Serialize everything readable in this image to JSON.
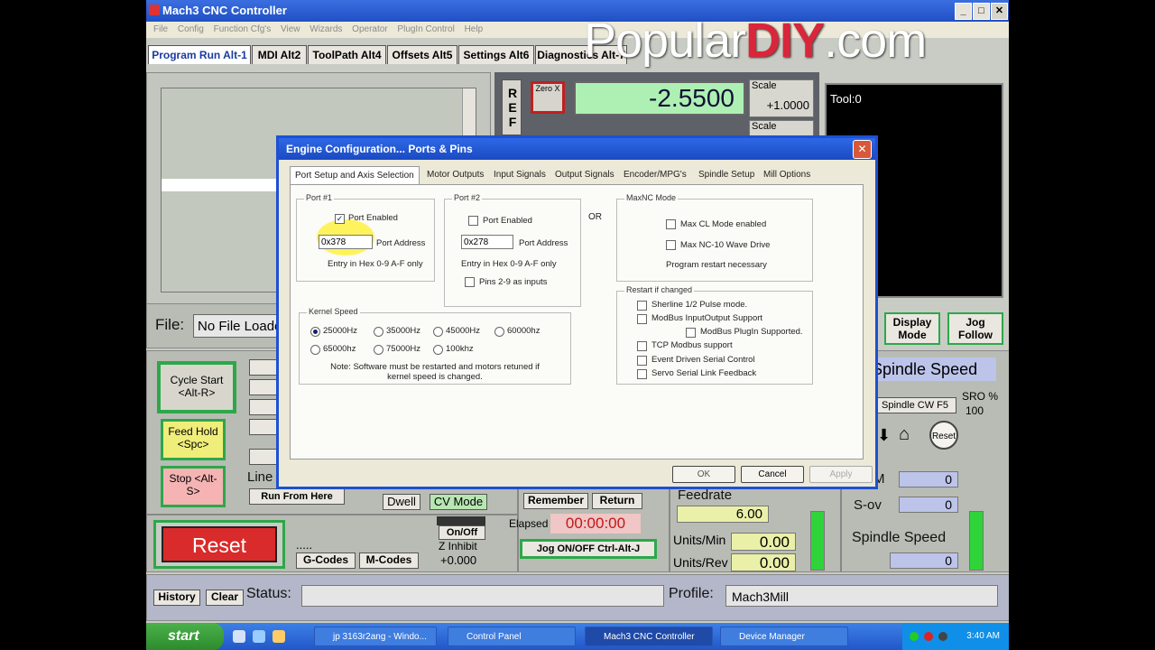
{
  "window": {
    "title": "Mach3 CNC Controller"
  },
  "watermark": {
    "part1": "Popular",
    "part2": "DIY",
    "part3": ".com"
  },
  "menubar": [
    "File",
    "Config",
    "Function Cfg's",
    "View",
    "Wizards",
    "Operator",
    "PlugIn Control",
    "Help"
  ],
  "screen_tabs": [
    {
      "label": "Program Run Alt-1"
    },
    {
      "label": "MDI Alt2"
    },
    {
      "label": "ToolPath Alt4"
    },
    {
      "label": "Offsets Alt5"
    },
    {
      "label": "Settings Alt6"
    },
    {
      "label": "Diagnostics Alt-7"
    }
  ],
  "dro": {
    "ref_label": "REF",
    "zero_x_label": "Zero X",
    "x_value": "-2.5500",
    "scale_label": "Scale",
    "scale_value": "+1.0000",
    "scale_label2": "Scale"
  },
  "tool": {
    "label": "Tool:0"
  },
  "file": {
    "label": "File:",
    "value": "No File Loaded."
  },
  "buttons": {
    "cycle_start": "Cycle Start <Alt-R>",
    "feed_hold": "Feed Hold <Spc>",
    "stop": "Stop <Alt-S>",
    "reset": "Reset",
    "run_from_here": "Run From Here",
    "line_label": "Line",
    "dwell": "Dwell",
    "cv_mode": "CV Mode",
    "remember": "Remember",
    "return": "Return",
    "jog_onoff": "Jog ON/OFF Ctrl-Alt-J",
    "onoff": "On/Off",
    "z_inhibit": "Z Inhibit",
    "z_inhibit_value": "+0.000",
    "gcodes": "G-Codes",
    "mcodes": "M-Codes",
    "display_mode": "Display Mode",
    "jog_follow": "Jog Follow",
    "spindle_cw": "Spindle CW F5",
    "reset_small": "Reset",
    "history": "History",
    "clear": "Clear",
    "dots": "....."
  },
  "elapsed": {
    "label": "Elapsed",
    "value": "00:00:00"
  },
  "feedrate": {
    "label": "Feedrate",
    "value": "6.00",
    "units_min_label": "Units/Min",
    "units_min": "0.00",
    "units_rev_label": "Units/Rev",
    "units_rev": "0.00"
  },
  "spindle": {
    "header": "Spindle Speed",
    "sro_label": "SRO %",
    "sro_value": "100",
    "rpm_label": "M",
    "rpm_value": "0",
    "sov_label": "S-ov",
    "sov_value": "0",
    "speed_label": "Spindle Speed",
    "speed_value": "0"
  },
  "status": {
    "label": "Status:",
    "profile_label": "Profile:",
    "profile_value": "Mach3Mill"
  },
  "dialog": {
    "title": "Engine Configuration... Ports & Pins",
    "tabs": [
      "Port Setup and Axis Selection",
      "Motor Outputs",
      "Input Signals",
      "Output Signals",
      "Encoder/MPG's",
      "Spindle Setup",
      "Mill Options"
    ],
    "port1": {
      "title": "Port #1",
      "enabled_label": "Port Enabled",
      "enabled": true,
      "address": "0x378",
      "address_label": "Port Address",
      "hint": "Entry in Hex 0-9 A-F only"
    },
    "port2": {
      "title": "Port #2",
      "enabled_label": "Port Enabled",
      "enabled": false,
      "address": "0x278",
      "address_label": "Port Address",
      "hint": "Entry in Hex 0-9 A-F only",
      "pins_label": "Pins 2-9 as inputs"
    },
    "or_label": "OR",
    "maxnc": {
      "title": "MaxNC Mode",
      "cl_label": "Max CL Mode enabled",
      "nc10_label": "Max NC-10 Wave Drive",
      "restart_note": "Program restart necessary"
    },
    "kernel": {
      "title": "Kernel Speed",
      "options": [
        "25000Hz",
        "35000Hz",
        "45000Hz",
        "60000hz",
        "65000hz",
        "75000Hz",
        "100khz"
      ],
      "selected": "25000Hz",
      "note": "Note: Software must be restarted and motors retuned if kernel speed is changed."
    },
    "restart": {
      "title": "Restart if changed",
      "options": [
        "Sherline 1/2 Pulse mode.",
        "ModBus InputOutput Support",
        "ModBus PlugIn Supported.",
        "TCP Modbus support",
        "Event Driven Serial Control",
        "Servo Serial Link Feedback"
      ]
    },
    "ok": "OK",
    "cancel": "Cancel",
    "apply": "Apply"
  },
  "taskbar": {
    "start": "start",
    "tasks": [
      "jp 3163r2ang - Windo...",
      "Control Panel",
      "Mach3 CNC Controller",
      "Device Manager"
    ],
    "clock": "3:40 AM"
  },
  "colors": {
    "accent": "#1e50d2",
    "dro_bg": "#aef0b4",
    "green": "#2ca84a",
    "red": "#d9263a"
  }
}
